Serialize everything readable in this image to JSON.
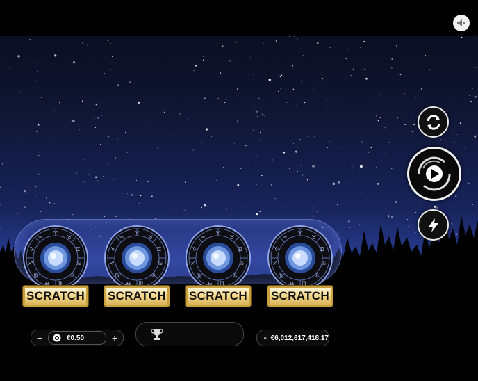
{
  "tickets": [
    {
      "label": "SCRATCH"
    },
    {
      "label": "SCRATCH"
    },
    {
      "label": "SCRATCH"
    },
    {
      "label": "SCRATCH"
    }
  ],
  "controls": {
    "mute_icon": "speaker-muted-icon",
    "reload_icon": "refresh-icon",
    "play_icon": "play-icon",
    "turbo_icon": "lightning-icon"
  },
  "bet": {
    "minus": "−",
    "plus": "+",
    "value": "€0.50",
    "icon": "chip-icon"
  },
  "win": {
    "icon": "trophy-icon",
    "value": ""
  },
  "balance": {
    "icon": "wallet-icon",
    "value": "€6,012,617,418.17"
  },
  "colors": {
    "scratch_gold": "#d9b45a",
    "sky_top": "#0b0f22",
    "sky_horizon": "#2a3f96"
  }
}
